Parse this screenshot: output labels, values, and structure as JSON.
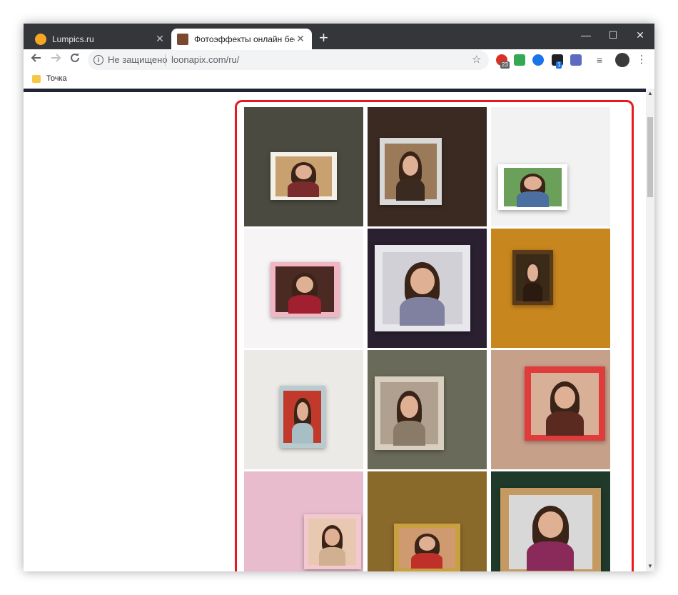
{
  "browser": {
    "tabs": [
      {
        "title": "Lumpics.ru",
        "active": false,
        "favicon_color": "#f6a623"
      },
      {
        "title": "Фотоэффекты онлайн бесплатно",
        "active": true,
        "favicon_color": "#7a4a30"
      }
    ],
    "new_tab_label": "+",
    "window_controls": {
      "minimize": "—",
      "maximize": "☐",
      "close": "✕"
    }
  },
  "toolbar": {
    "security_label": "Не защищено",
    "url": "loonapix.com/ru/",
    "extensions": [
      {
        "icon": "adblock-icon",
        "color": "#d93025",
        "badge": "23",
        "badge_color": "#5f6368"
      },
      {
        "icon": "music-icon",
        "color": "#34a853",
        "badge": ""
      },
      {
        "icon": "globe-icon",
        "color": "#1a73e8",
        "badge": ""
      },
      {
        "icon": "cube-icon",
        "color": "#202124",
        "badge": "1",
        "badge_color": "#1a73e8"
      },
      {
        "icon": "translate-icon",
        "color": "#5c6bc0",
        "badge": ""
      },
      {
        "icon": "playlist-icon",
        "color": "#5f6368",
        "badge": ""
      }
    ]
  },
  "bookmarks": {
    "items": [
      {
        "label": "Точка"
      }
    ]
  },
  "colors": {
    "highlight": "#e8191e",
    "tabstrip": "#35363a",
    "page_header": "#1f2536"
  },
  "gallery": {
    "tiles": [
      {
        "name": "photo-effect-railway-polaroids",
        "bg": "#4a4a40",
        "frame": "#f3f0e8",
        "photo": "#c9a070",
        "body": "#7a2b2b"
      },
      {
        "name": "photo-effect-lamp-frame",
        "bg": "#3b2a22",
        "frame": "#d8d8d8",
        "photo": "#9a7a58",
        "body": "#3a2a20"
      },
      {
        "name": "photo-effect-tulips-family",
        "bg": "#f2f2f2",
        "frame": "#ffffff",
        "photo": "#6aa05a",
        "body": "#4a6fa0"
      },
      {
        "name": "photo-effect-pink-frame-kiss",
        "bg": "#f7f4f5",
        "frame": "#f0b6c4",
        "photo": "#4a2a22",
        "body": "#a02030"
      },
      {
        "name": "photo-effect-pencil-sketch",
        "bg": "#2a2030",
        "frame": "#e8e8ec",
        "photo": "#d0d0d6",
        "body": "#8080a0"
      },
      {
        "name": "photo-effect-woman-window",
        "bg": "#c8861e",
        "frame": "#5a3a18",
        "photo": "#3a2a18",
        "body": "#2a1a10"
      },
      {
        "name": "photo-effect-vogue-cover",
        "bg": "#eceae6",
        "frame": "#b8ccd0",
        "photo": "#c0392b",
        "body": "#a7bfc4"
      },
      {
        "name": "photo-effect-heart-sepia",
        "bg": "#6a6a5a",
        "frame": "#d8cfc0",
        "photo": "#b0a090",
        "body": "#8a7a68"
      },
      {
        "name": "photo-effect-heart-frame-couple",
        "bg": "#c7a08a",
        "frame": "#e03c3c",
        "photo": "#d8b098",
        "body": "#5a2a20"
      },
      {
        "name": "photo-effect-birthday-cupcake",
        "bg": "#e8bccc",
        "frame": "#f3c9cf",
        "photo": "#e8c8b0",
        "body": "#d0b090"
      },
      {
        "name": "photo-effect-party-friends",
        "bg": "#8a6a2a",
        "frame": "#c8a040",
        "photo": "#d09a70",
        "body": "#c0302a"
      },
      {
        "name": "photo-effect-winter-wood-frame",
        "bg": "#1f3a2a",
        "frame": "#c49a62",
        "photo": "#d8d8d8",
        "body": "#8a2a5a"
      }
    ]
  }
}
